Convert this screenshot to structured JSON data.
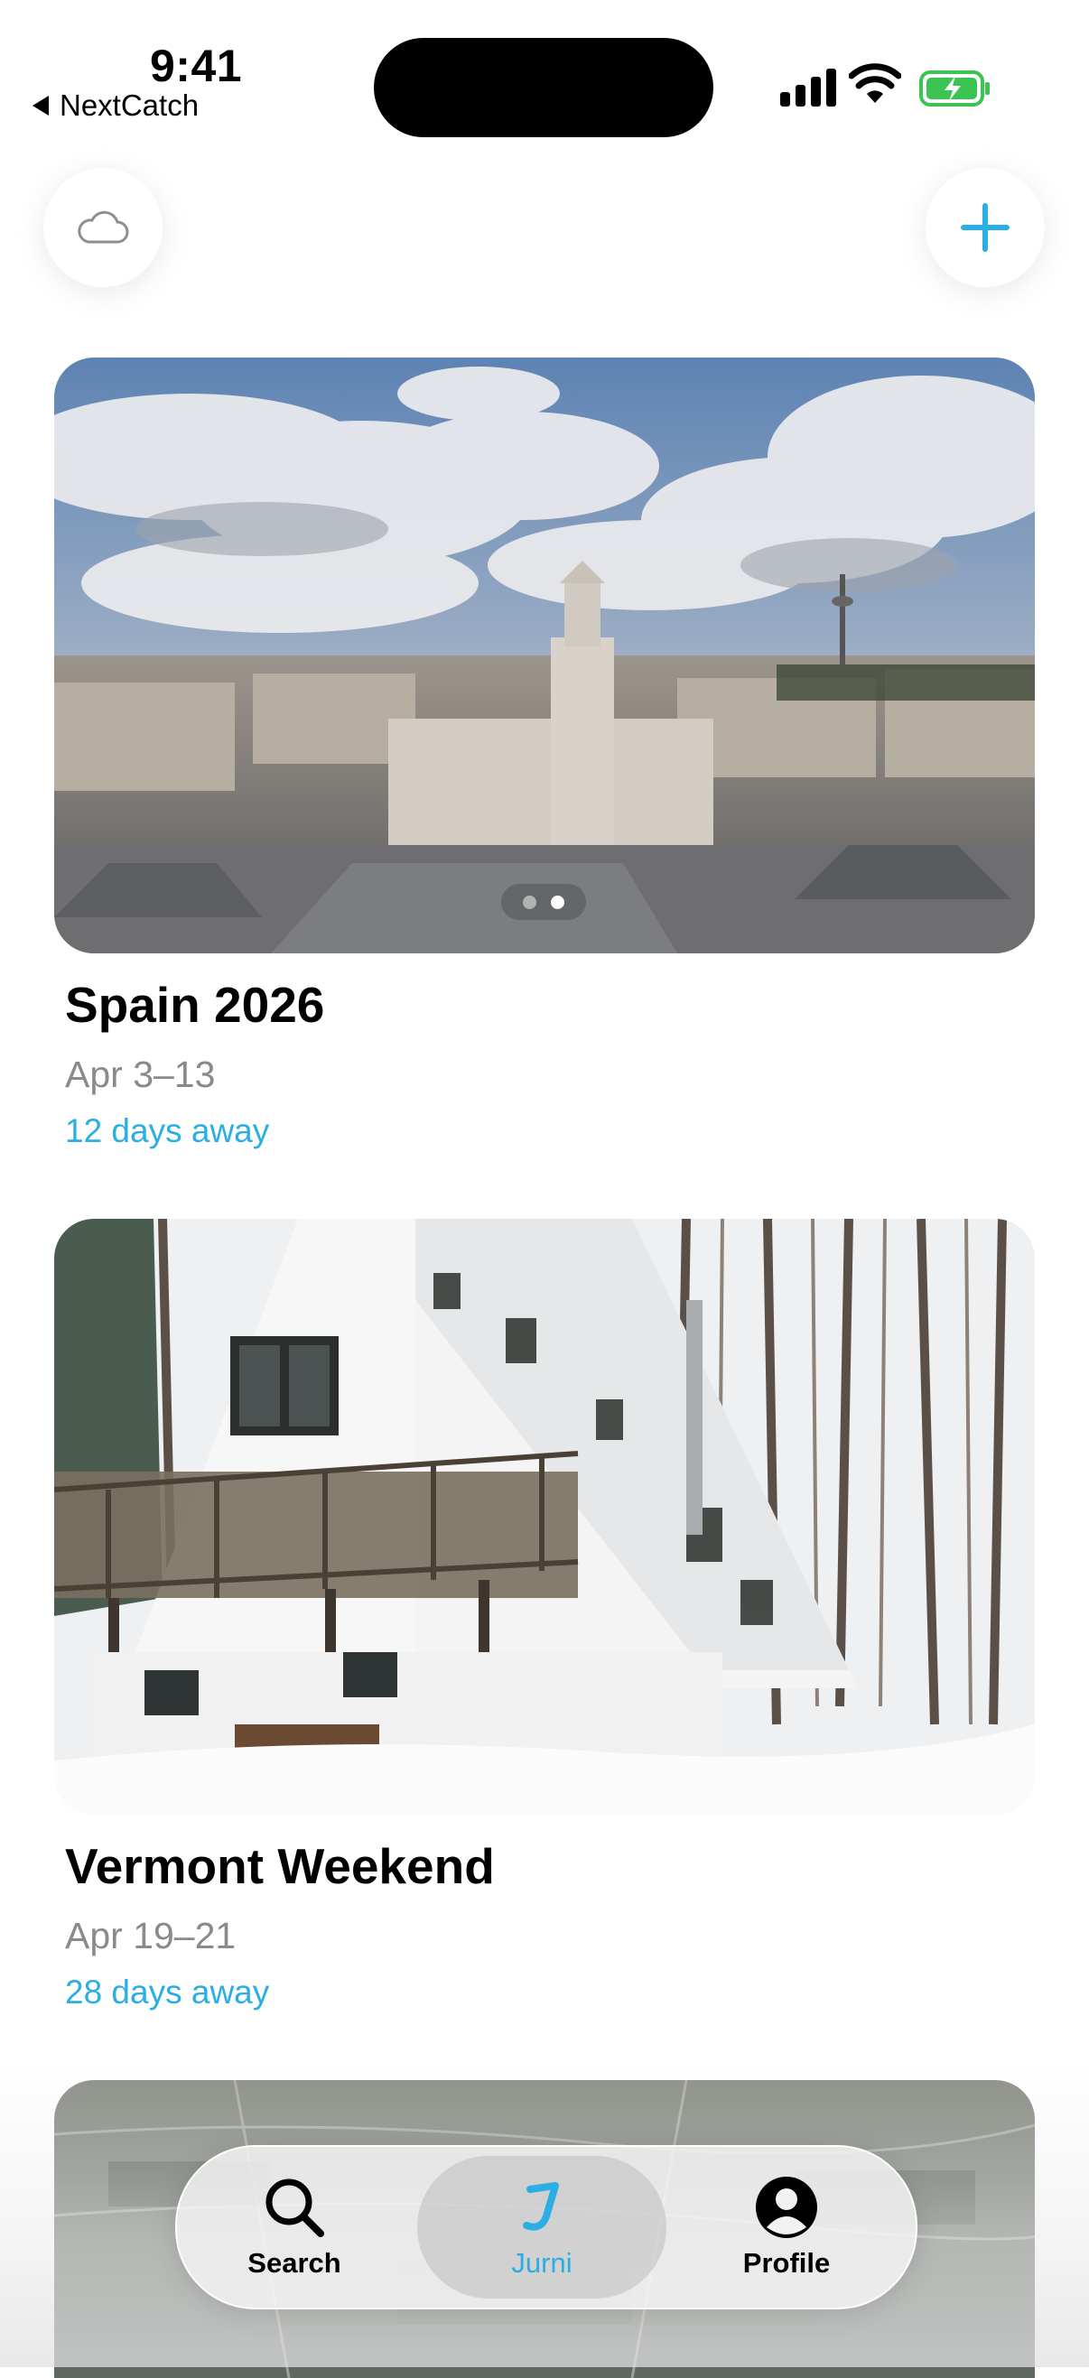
{
  "status_bar": {
    "time": "9:41",
    "back_label": "NextCatch"
  },
  "header": {
    "left_icon": "cloud-icon",
    "right_icon": "plus-icon",
    "accent_color": "#2aaee4"
  },
  "trips": [
    {
      "title": "Spain 2026",
      "dates": "Apr 3–13",
      "countdown": "12 days away",
      "photo": "madrid-cityscape",
      "photo_pages": 2,
      "photo_current_page": 2
    },
    {
      "title": "Vermont Weekend",
      "dates": "Apr 19–21",
      "countdown": "28 days away",
      "photo": "snowy-a-frame-cabin"
    },
    {
      "photo": "aerial-landscape"
    }
  ],
  "tab_bar": {
    "tabs": [
      {
        "label": "Search",
        "icon": "magnifier-icon",
        "selected": false
      },
      {
        "label": "Jurni",
        "icon": "jurni-logo-icon",
        "selected": true
      },
      {
        "label": "Profile",
        "icon": "person-icon",
        "selected": false
      }
    ]
  }
}
